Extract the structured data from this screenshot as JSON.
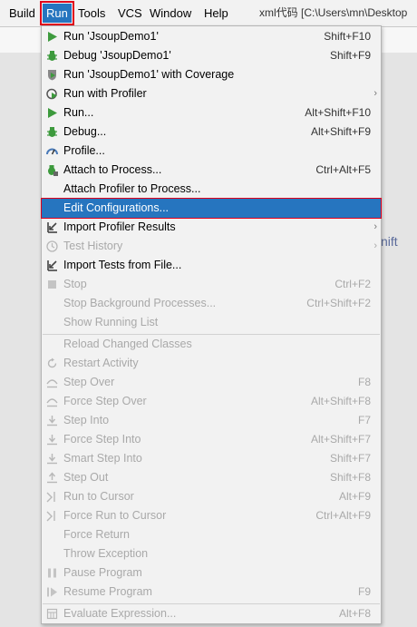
{
  "menubar": {
    "items": [
      "Build",
      "Run",
      "Tools",
      "VCS",
      "Window",
      "Help"
    ],
    "title": "xml代码 [C:\\Users\\mn\\Desktop"
  },
  "background": {
    "partial_text": "nift"
  },
  "menu": {
    "items": [
      {
        "label": "Run 'JsoupDemo1'",
        "shortcut": "Shift+F10",
        "icon": "run-icon"
      },
      {
        "label": "Debug 'JsoupDemo1'",
        "shortcut": "Shift+F9",
        "icon": "debug-icon"
      },
      {
        "label": "Run 'JsoupDemo1' with Coverage",
        "shortcut": "",
        "icon": "coverage-icon"
      },
      {
        "label": "Run with Profiler",
        "shortcut": "",
        "icon": "profiler-run-icon",
        "submenu": true
      },
      {
        "label": "Run...",
        "shortcut": "Alt+Shift+F10",
        "icon": "run-icon"
      },
      {
        "label": "Debug...",
        "shortcut": "Alt+Shift+F9",
        "icon": "debug-icon"
      },
      {
        "label": "Profile...",
        "shortcut": "",
        "icon": "profile-gauge-icon"
      },
      {
        "label": "Attach to Process...",
        "shortcut": "Ctrl+Alt+F5",
        "icon": "attach-bug-icon"
      },
      {
        "label": "Attach Profiler to Process...",
        "shortcut": "",
        "icon": ""
      },
      {
        "label": "Edit Configurations...",
        "shortcut": "",
        "icon": "",
        "selected": true
      },
      {
        "label": "Import Profiler Results",
        "shortcut": "",
        "icon": "import-icon",
        "submenu": true
      },
      {
        "label": "Test History",
        "shortcut": "",
        "icon": "history-clock-icon",
        "submenu": true,
        "disabled": true
      },
      {
        "label": "Import Tests from File...",
        "shortcut": "",
        "icon": "import-icon"
      },
      {
        "label": "Stop",
        "shortcut": "Ctrl+F2",
        "icon": "stop-icon",
        "disabled": true
      },
      {
        "label": "Stop Background Processes...",
        "shortcut": "Ctrl+Shift+F2",
        "icon": "",
        "disabled": true
      },
      {
        "label": "Show Running List",
        "shortcut": "",
        "icon": "",
        "disabled": true
      },
      {
        "label": "Reload Changed Classes",
        "shortcut": "",
        "icon": "",
        "disabled": true
      },
      {
        "label": "Restart Activity",
        "shortcut": "",
        "icon": "restart-icon",
        "disabled": true
      },
      {
        "label": "Step Over",
        "shortcut": "F8",
        "icon": "step-over-icon",
        "disabled": true
      },
      {
        "label": "Force Step Over",
        "shortcut": "Alt+Shift+F8",
        "icon": "step-over-icon",
        "disabled": true
      },
      {
        "label": "Step Into",
        "shortcut": "F7",
        "icon": "step-into-icon",
        "disabled": true
      },
      {
        "label": "Force Step Into",
        "shortcut": "Alt+Shift+F7",
        "icon": "step-into-icon",
        "disabled": true
      },
      {
        "label": "Smart Step Into",
        "shortcut": "Shift+F7",
        "icon": "step-into-icon",
        "disabled": true
      },
      {
        "label": "Step Out",
        "shortcut": "Shift+F8",
        "icon": "step-out-icon",
        "disabled": true
      },
      {
        "label": "Run to Cursor",
        "shortcut": "Alt+F9",
        "icon": "run-to-cursor-icon",
        "disabled": true
      },
      {
        "label": "Force Run to Cursor",
        "shortcut": "Ctrl+Alt+F9",
        "icon": "run-to-cursor-icon",
        "disabled": true
      },
      {
        "label": "Force Return",
        "shortcut": "",
        "icon": "",
        "disabled": true
      },
      {
        "label": "Throw Exception",
        "shortcut": "",
        "icon": "",
        "disabled": true
      },
      {
        "label": "Pause Program",
        "shortcut": "",
        "icon": "pause-icon",
        "disabled": true
      },
      {
        "label": "Resume Program",
        "shortcut": "F9",
        "icon": "resume-icon",
        "disabled": true
      },
      {
        "label": "Evaluate Expression...",
        "shortcut": "Alt+F8",
        "icon": "calculator-icon",
        "disabled": true
      }
    ]
  },
  "colors": {
    "selection": "#2675bf",
    "highlight_border": "#e0001b",
    "run_green": "#3d9a3d",
    "disabled_gray": "#a9a9a9"
  }
}
